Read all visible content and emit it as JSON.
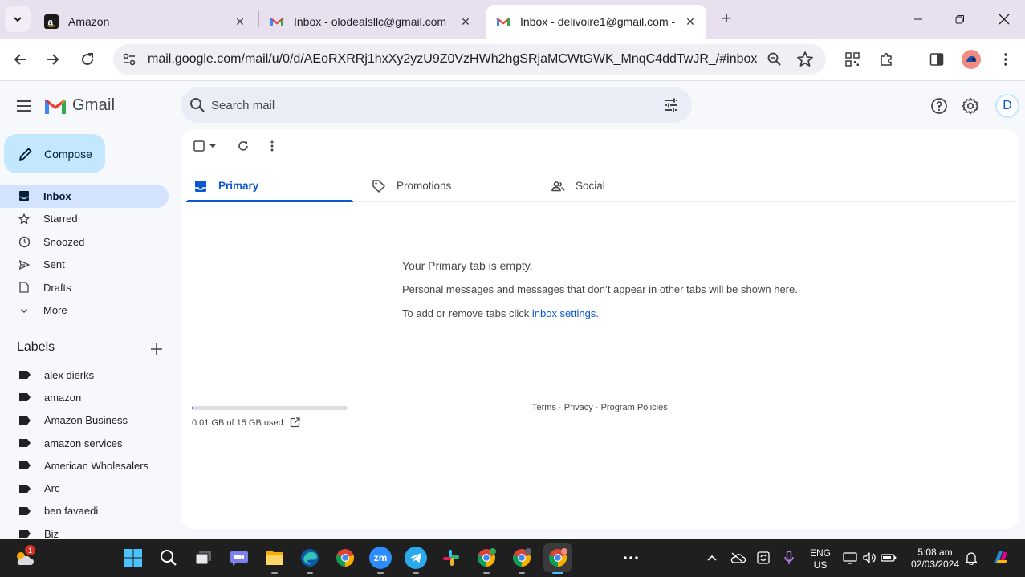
{
  "browser": {
    "tabs": [
      {
        "title": "Amazon",
        "favicon": "amazon-icon"
      },
      {
        "title": "Inbox - olodealsllc@gmail.com",
        "favicon": "gmail-icon"
      },
      {
        "title": "Inbox - delivoire1@gmail.com - ",
        "favicon": "gmail-icon",
        "active": true
      }
    ],
    "url": "mail.google.com/mail/u/0/d/AEoRXRRj1hxXy2yzU9Z0VzHWh2hgSRjaMCWtGWK_MnqC4ddTwJR_/#inbox"
  },
  "gmail": {
    "product_name": "Gmail",
    "search_placeholder": "Search mail",
    "avatar_initial": "D",
    "compose_label": "Compose",
    "nav": [
      {
        "label": "Inbox",
        "icon": "inbox-icon",
        "active": true
      },
      {
        "label": "Starred",
        "icon": "star-icon"
      },
      {
        "label": "Snoozed",
        "icon": "clock-icon"
      },
      {
        "label": "Sent",
        "icon": "send-icon"
      },
      {
        "label": "Drafts",
        "icon": "draft-icon"
      },
      {
        "label": "More",
        "icon": "chevron-down-icon"
      }
    ],
    "labels_heading": "Labels",
    "labels": [
      "alex dierks",
      "amazon",
      "Amazon Business",
      "amazon services",
      "American Wholesalers",
      "Arc",
      "ben favaedi",
      "Biz"
    ],
    "tabs": [
      {
        "label": "Primary",
        "icon": "inbox-tab-icon",
        "active": true
      },
      {
        "label": "Promotions",
        "icon": "tag-icon"
      },
      {
        "label": "Social",
        "icon": "people-icon"
      }
    ],
    "empty": {
      "title": "Your Primary tab is empty.",
      "line1": "Personal messages and messages that don’t appear in other tabs will be shown here.",
      "line2_prefix": "To add or remove tabs click ",
      "line2_link": "inbox settings",
      "line2_suffix": "."
    },
    "storage": {
      "text": "0.01 GB of 15 GB used",
      "used_fraction": 0.0007
    },
    "footer": {
      "terms": "Terms",
      "sep": " · ",
      "privacy": "Privacy",
      "policies": "Program Policies"
    },
    "colors": {
      "accent": "#0b57d0",
      "compose_bg": "#c2e7ff",
      "active_nav_bg": "#d3e3fd"
    }
  },
  "taskbar": {
    "weather_badge": "1",
    "language": "ENG",
    "region": "US",
    "time": "5:08 am",
    "date": "02/03/2024",
    "zoom_label": "zm"
  }
}
